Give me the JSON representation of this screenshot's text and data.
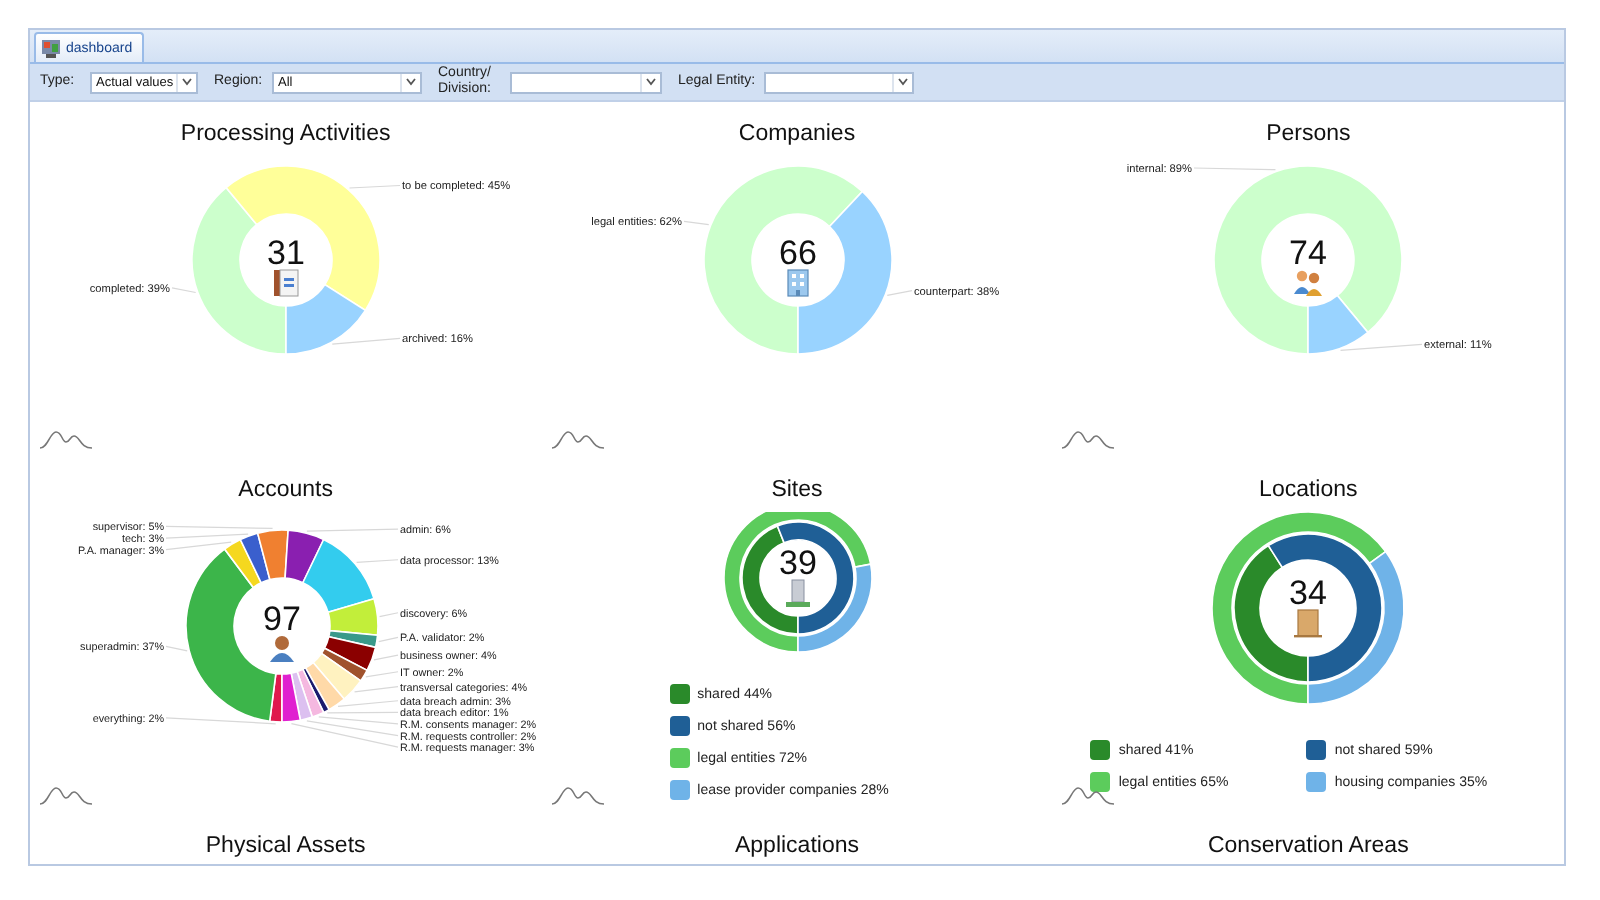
{
  "tab": {
    "label": "dashboard",
    "selected": true
  },
  "filters": [
    {
      "label": "Type:",
      "value": "Actual values"
    },
    {
      "label": "Region:",
      "value": "All"
    },
    {
      "label": "Country/ Division:"
    },
    {
      "label": "Legal Entity:"
    }
  ],
  "panels": [
    {
      "title": "Processing Activities",
      "total": "31",
      "kind": "donut",
      "chart_data": {
        "type": "donut",
        "values": [
          39,
          45,
          16
        ],
        "colors": [
          "#ccffcc",
          "#ffff99",
          "#99d3ff"
        ],
        "value_labels": [
          "completed: 39%",
          "to be completed: 45%",
          "archived: 16%"
        ]
      }
    },
    {
      "title": "Companies",
      "total": "66",
      "kind": "donut",
      "chart_data": {
        "type": "donut",
        "values": [
          62,
          38
        ],
        "colors": [
          "#ccffcc",
          "#99d3ff"
        ],
        "value_labels": [
          "legal entities: 62%",
          "counterpart: 38%"
        ]
      }
    },
    {
      "title": "Persons",
      "total": "74",
      "kind": "donut",
      "chart_data": {
        "type": "donut",
        "values": [
          89,
          11
        ],
        "colors": [
          "#ccffcc",
          "#99d3ff"
        ],
        "value_labels": [
          "internal: 89%",
          "external: 11%"
        ]
      }
    },
    {
      "title": "Accounts",
      "total": "97",
      "kind": "donut",
      "chart_data": {
        "type": "donut",
        "values": [
          2,
          37,
          3,
          3,
          5,
          6,
          13,
          6,
          2,
          4,
          2,
          4,
          3,
          1,
          2,
          2,
          3
        ],
        "colors": [
          "#e0194d",
          "#3cb54a",
          "#f5d81f",
          "#3a5fcd",
          "#f08030",
          "#8a1fb0",
          "#33ccee",
          "#c2ee3a",
          "#3a9a8a",
          "#8b0000",
          "#a0522d",
          "#fff2c0",
          "#ffd9a8",
          "#1a1a6e",
          "#f5b8e0",
          "#dcc0f0",
          "#e020d0"
        ],
        "value_labels": [
          "everything: 2%",
          "superadmin: 37%",
          "P.A. manager: 3%",
          "tech: 3%",
          "supervisor: 5%",
          "admin: 6%",
          "data processor: 13%",
          "discovery: 6%",
          "P.A. validator: 2%",
          "business owner: 4%",
          "IT owner: 2%",
          "transversal categories: 4%",
          "data breach admin: 3%",
          "data breach editor: 1%",
          "R.M. consents manager: 2%",
          "R.M. requests controller: 2%",
          "R.M. requests manager: 3%"
        ]
      }
    },
    {
      "title": "Sites",
      "total": "39",
      "kind": "nested_list",
      "chart_data": {
        "type": "donut",
        "series": [
          {
            "values": [
              44,
              56
            ],
            "colors": [
              "#2a8a2a",
              "#1f5f96"
            ]
          },
          {
            "values": [
              72,
              28
            ],
            "colors": [
              "#5ccc5c",
              "#6fb3e8"
            ]
          }
        ]
      },
      "legend": [
        {
          "label": "shared 44%",
          "color": "#2a8a2a"
        },
        {
          "label": "not shared 56%",
          "color": "#1f5f96"
        },
        {
          "label": "legal entities 72%",
          "color": "#5ccc5c"
        },
        {
          "label": "lease provider companies 28%",
          "color": "#6fb3e8"
        }
      ]
    },
    {
      "title": "Locations",
      "total": "34",
      "kind": "nested_grid",
      "chart_data": {
        "type": "donut",
        "series": [
          {
            "values": [
              41,
              59
            ],
            "colors": [
              "#2a8a2a",
              "#1f5f96"
            ]
          },
          {
            "values": [
              65,
              35
            ],
            "colors": [
              "#5ccc5c",
              "#6fb3e8"
            ]
          }
        ]
      },
      "legend": [
        {
          "label": "shared 41%",
          "color": "#2a8a2a"
        },
        {
          "label": "not shared 59%",
          "color": "#1f5f96"
        },
        {
          "label": "legal entities 65%",
          "color": "#5ccc5c"
        },
        {
          "label": "housing companies 35%",
          "color": "#6fb3e8"
        }
      ]
    },
    {
      "title": "Physical Assets",
      "kind": "empty"
    },
    {
      "title": "Applications",
      "kind": "empty"
    },
    {
      "title": "Conservation Areas",
      "kind": "empty"
    }
  ]
}
